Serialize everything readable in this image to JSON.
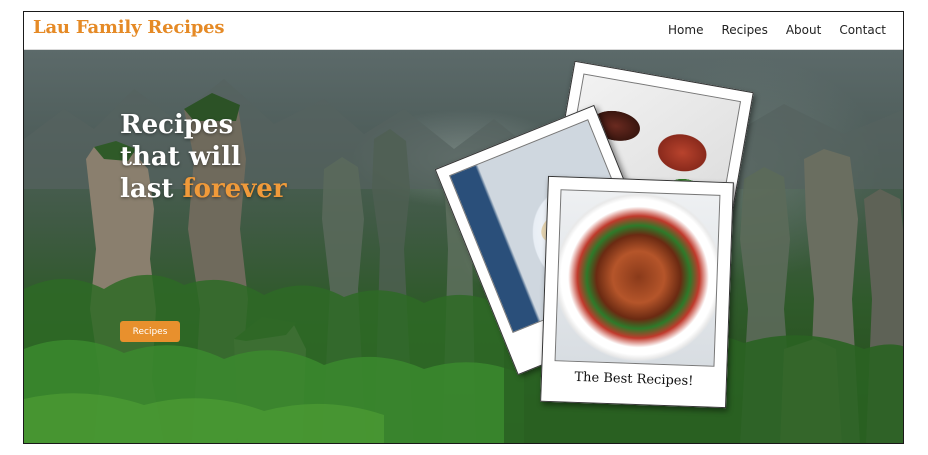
{
  "site": {
    "brand": "Lau Family Recipes"
  },
  "nav": {
    "items": [
      "Home",
      "Recipes",
      "About",
      "Contact"
    ]
  },
  "hero": {
    "title_line1": "Recipes",
    "title_line2": "that will",
    "title_line3_prefix": "last ",
    "title_line3_accent": "forever",
    "cta_label": "Recipes"
  },
  "polaroids": {
    "caption": "The Best Recipes!"
  },
  "colors": {
    "accent": "#e58a26",
    "button": "#e8902d",
    "nav_bg": "#ffffff"
  }
}
